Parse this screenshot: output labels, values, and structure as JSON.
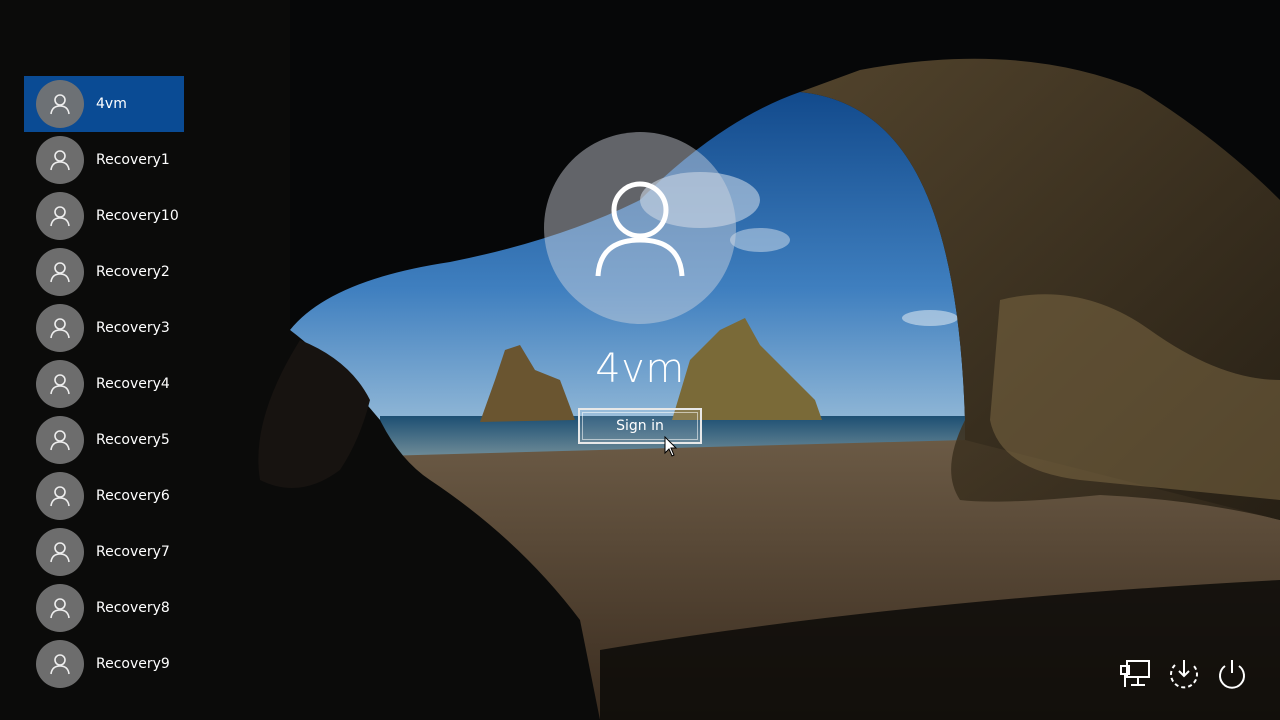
{
  "users": [
    {
      "name": "4vm",
      "selected": true
    },
    {
      "name": "Recovery1"
    },
    {
      "name": "Recovery10"
    },
    {
      "name": "Recovery2"
    },
    {
      "name": "Recovery3"
    },
    {
      "name": "Recovery4"
    },
    {
      "name": "Recovery5"
    },
    {
      "name": "Recovery6"
    },
    {
      "name": "Recovery7"
    },
    {
      "name": "Recovery8"
    },
    {
      "name": "Recovery9"
    }
  ],
  "current_user": {
    "name": "4vm"
  },
  "signin": {
    "label": "Sign in"
  },
  "corner_icons": [
    "network-icon",
    "ease-of-access-icon",
    "power-icon"
  ],
  "colors": {
    "selected": "#0a4b94",
    "avatar": "#737373"
  }
}
